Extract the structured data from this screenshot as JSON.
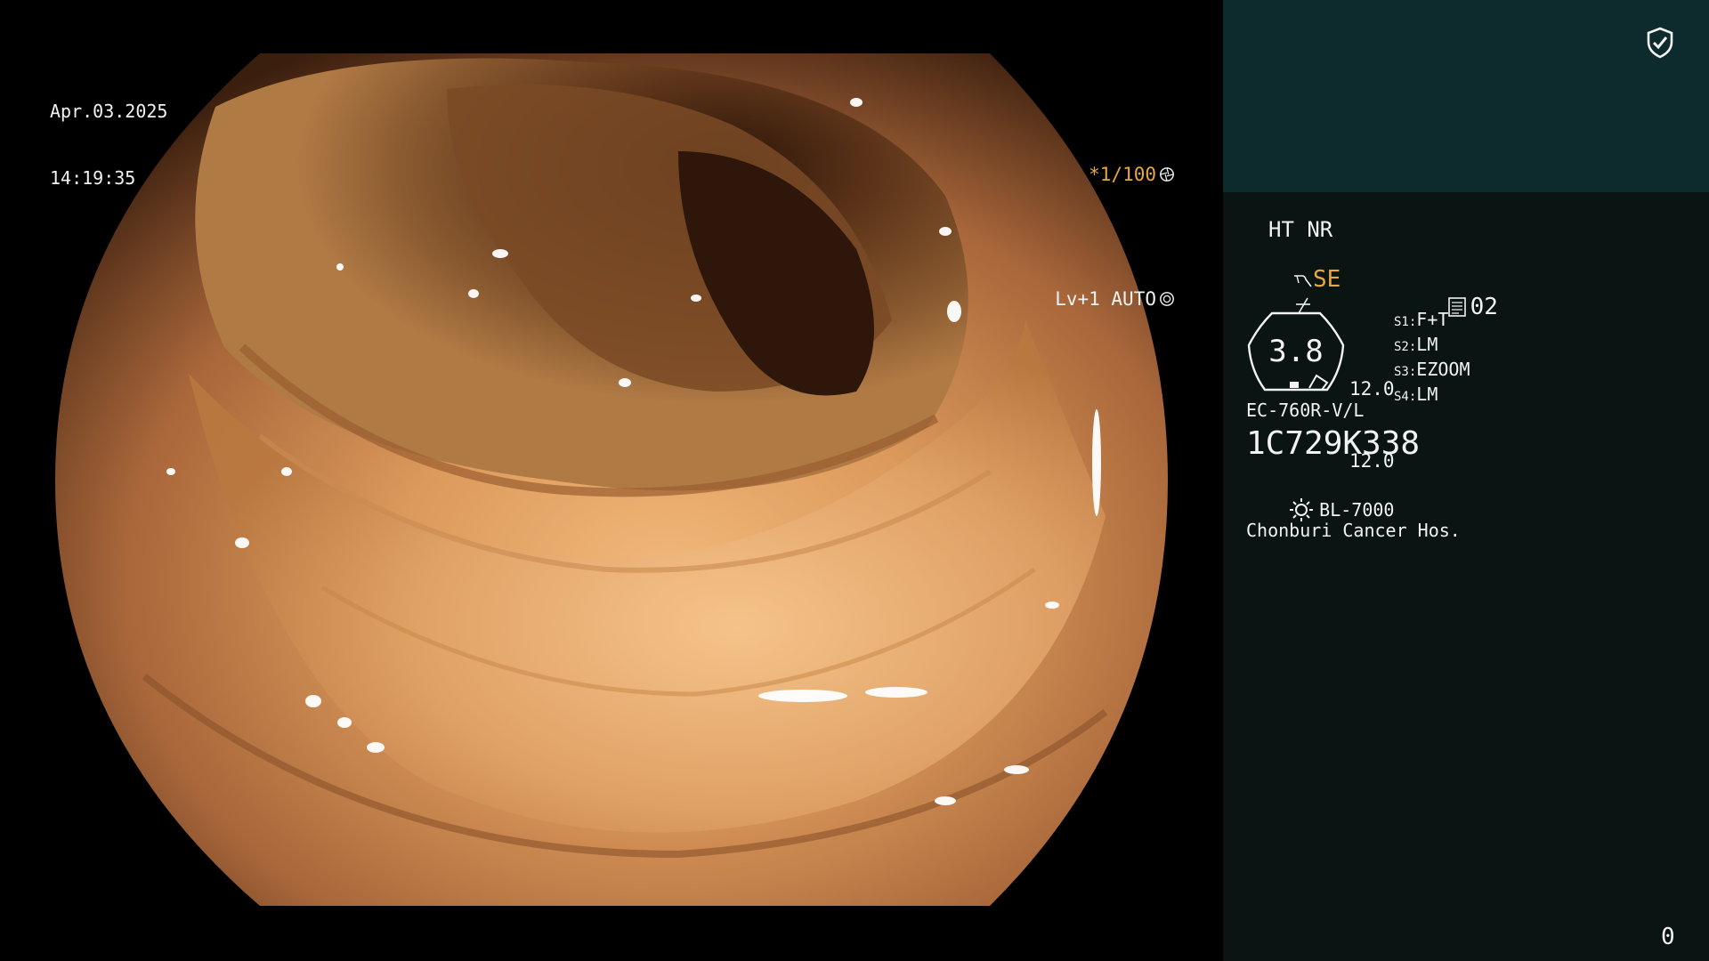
{
  "header": {
    "date": "Apr.03.2025",
    "time": "14:19:35"
  },
  "freeze": {
    "shutter": "*1/100",
    "shutter_icon": "aperture-icon",
    "mode": "Lv+1 AUTO",
    "mode_icon": "iris-icon"
  },
  "panel": {
    "security_icon": "shield-check-icon",
    "ht_nr": "HT NR",
    "se_label": "SE",
    "memo_number": "02",
    "zoom": "3.8",
    "iris_values": [
      "12.0",
      "12.0"
    ],
    "switches": [
      {
        "key": "S1:",
        "value": "F+T"
      },
      {
        "key": "S2:",
        "value": "LM"
      },
      {
        "key": "S3:",
        "value": "EZOOM"
      },
      {
        "key": "S4:",
        "value": "LM"
      }
    ],
    "scope_model": "EC-760R-V/L",
    "scope_serial": "1C729K338",
    "light_source": "BL-7000",
    "hospital": "Chonburi Cancer Hos.",
    "counter": "0"
  },
  "colors": {
    "accent": "#e8a83a",
    "panel_top": "#0d2b2c",
    "panel_bottom": "#091413",
    "text": "#f2f2f2"
  }
}
